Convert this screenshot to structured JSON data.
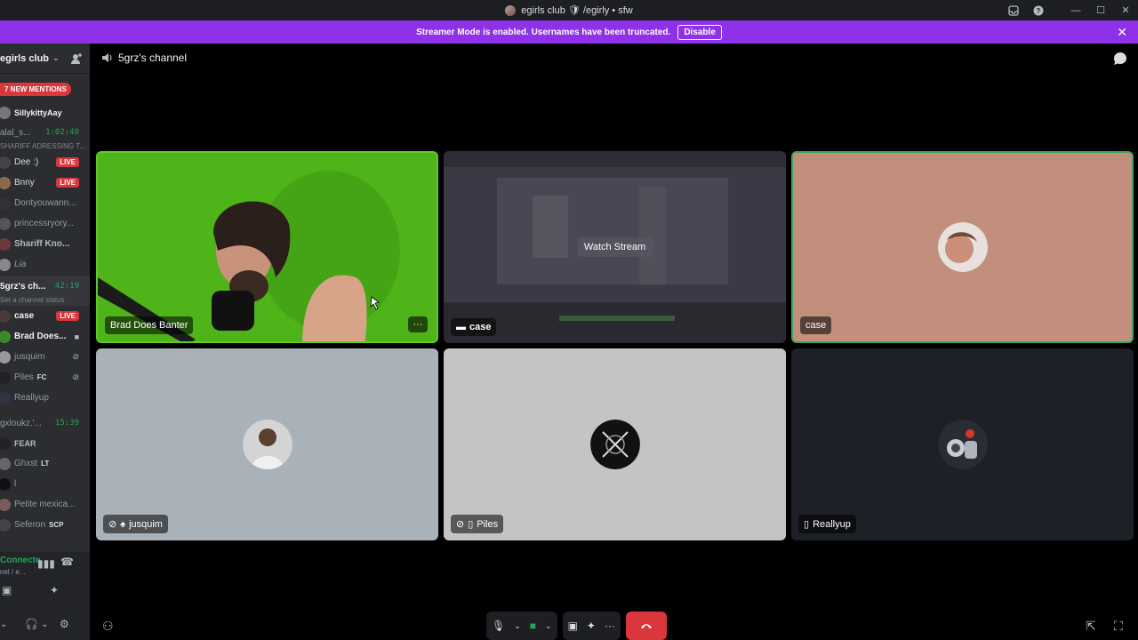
{
  "window": {
    "title": "egirls club 🛡 /egirly • sfw"
  },
  "banner": {
    "text": "Streamer Mode is enabled. Usernames have been truncated.",
    "disable_label": "Disable"
  },
  "sidebar": {
    "server_name": "egirls club",
    "mentions_label": "7 NEW MENTIONS",
    "top_users": [
      {
        "name": "SillykittyAay"
      }
    ],
    "channel_1": {
      "name": "alal_s...",
      "timer": "1:02:40",
      "status": "SHARIFF ADRESSING T..."
    },
    "channel_1_users": [
      {
        "name": "Dee :)",
        "badge": "LIVE"
      },
      {
        "name": "Bnny",
        "badge": "LIVE"
      },
      {
        "name": "Dontyouwann..."
      },
      {
        "name": "princessryory..."
      },
      {
        "name": "Shariff Kno..."
      },
      {
        "name": "Lia"
      }
    ],
    "channel_2": {
      "name": "5grz's ch...",
      "timer": "42:19",
      "status": "Set a channel status"
    },
    "channel_2_users": [
      {
        "name": "case",
        "badge": "LIVE"
      },
      {
        "name": "Brad Does..."
      },
      {
        "name": "jusquim"
      },
      {
        "name": "Piles",
        "tag": "FC"
      },
      {
        "name": "Reallyup"
      }
    ],
    "channel_3": {
      "name": "gxloukz.'...",
      "timer": "15:39"
    },
    "channel_3_users": [
      {
        "name": "FEAR"
      },
      {
        "name": "Ghxst",
        "tag": "LT"
      },
      {
        "name": "l"
      },
      {
        "name": "Petite mexica..."
      },
      {
        "name": "Seferon",
        "tag": "SCP"
      }
    ],
    "voice": {
      "status": "Connecte",
      "sub": "nel / e..."
    }
  },
  "main": {
    "channel_title": "5grz's channel",
    "tiles": [
      {
        "label": "Brad Does Banter"
      },
      {
        "label": "case",
        "overlay": "Watch Stream"
      },
      {
        "label": "case"
      },
      {
        "label": "jusquim"
      },
      {
        "label": "Piles"
      },
      {
        "label": "Reallyup"
      }
    ]
  },
  "colors": {
    "brand_purple": "#8e31e8",
    "live_red": "#da373c",
    "green": "#23a55a",
    "tile_green": "#4fb31a"
  }
}
